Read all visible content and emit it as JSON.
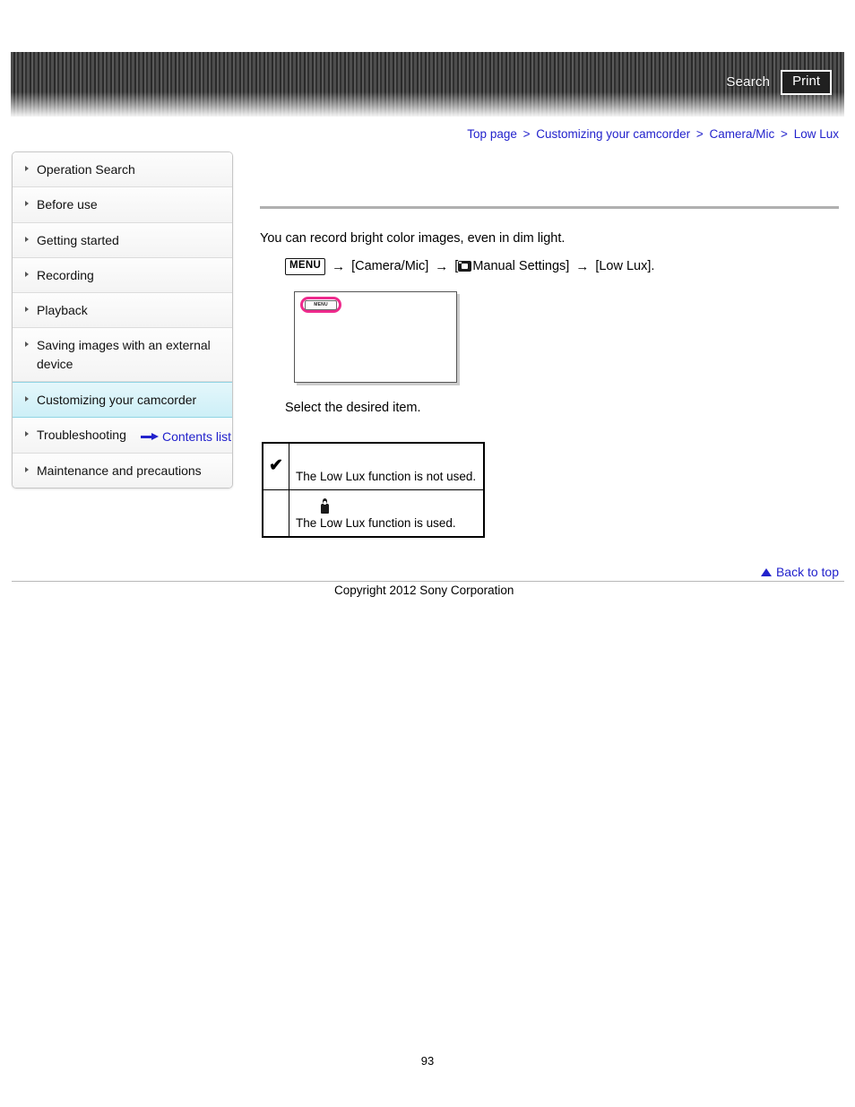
{
  "header": {
    "search_label": "Search",
    "print_label": "Print",
    "search_icon": "search-icon",
    "print_icon": "print-icon"
  },
  "breadcrumb": {
    "separator": ">",
    "items": [
      {
        "label": "Top page"
      },
      {
        "label": "Customizing your camcorder"
      },
      {
        "label": "Camera/Mic"
      },
      {
        "label": "Low Lux"
      }
    ]
  },
  "sidebar": {
    "items": [
      {
        "label": "Operation Search",
        "selected": false
      },
      {
        "label": "Before use",
        "selected": false
      },
      {
        "label": "Getting started",
        "selected": false
      },
      {
        "label": "Recording",
        "selected": false
      },
      {
        "label": "Playback",
        "selected": false
      },
      {
        "label": "Saving images with an external device",
        "selected": false
      },
      {
        "label": "Customizing your camcorder",
        "selected": true
      },
      {
        "label": "Troubleshooting",
        "selected": false
      },
      {
        "label": "Maintenance and precautions",
        "selected": false
      }
    ],
    "contents_list_label": "Contents list",
    "contents_list_icon": "arrow-right-icon"
  },
  "main": {
    "intro_text": "You can record bright color images, even in dim light.",
    "menu_path": {
      "menu_chip_label": "MENU",
      "arrow": "→",
      "step_camera_mic": "[Camera/Mic]",
      "bracket_open": "[",
      "manual_settings_icon": "manual-settings-icon",
      "step_manual_settings": "Manual Settings]",
      "step_low_lux": "[Low Lux]."
    },
    "illustration": {
      "menu_button_label": "MENU",
      "highlight_color": "#ee2a8c"
    },
    "select_item_text": "Select the desired item.",
    "options_table": {
      "rows": [
        {
          "mark": "✔",
          "mark_type": "check-glyph",
          "description": "The Low Lux function is not used."
        },
        {
          "mark": "",
          "mark_type": "none",
          "icon": "candle-icon",
          "description": "The Low Lux function is used."
        }
      ]
    }
  },
  "footer": {
    "back_to_top_label": "Back to top",
    "back_to_top_icon": "triangle-up-icon",
    "copyright": "Copyright 2012 Sony Corporation",
    "page_number": "93"
  }
}
